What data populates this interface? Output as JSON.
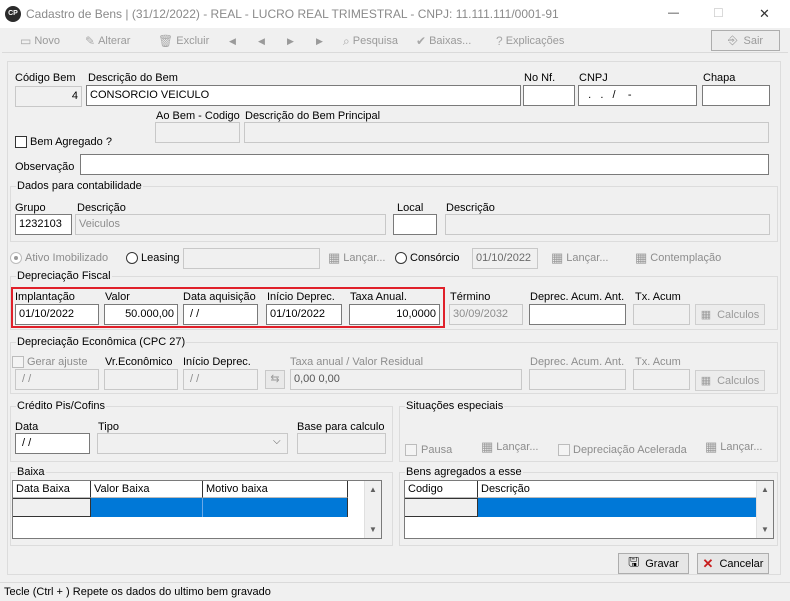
{
  "window": {
    "title": "Cadastro de Bens | (31/12/2022) - REAL - LUCRO REAL TRIMESTRAL  - CNPJ: 11.111.111/0001-91",
    "logo": "CP",
    "minimize": "—",
    "maximize": "☐",
    "close": "✕"
  },
  "toolbar": {
    "novo": "Novo",
    "alterar": "Alterar",
    "excluir": "Excluir",
    "pesquisa": "Pesquisa",
    "baixas": "Baixas...",
    "explicacoes": "Explicações",
    "sair": "Sair",
    "nav_first": "◀",
    "nav_prev": "◀",
    "nav_next": "▶",
    "nav_last": "▶"
  },
  "bem": {
    "codigo_label": "Código Bem",
    "codigo_value": "4",
    "descricao_label": "Descrição do Bem",
    "descricao_value": "CONSORCIO VEICULO",
    "nf_label": "No Nf.",
    "nf_value": "",
    "cnpj_label": "CNPJ",
    "cnpj_value": "  .   .   /    -",
    "chapa_label": "Chapa",
    "chapa_value": "",
    "agregado_label": "Bem Agregado ?",
    "ao_bem_label": "Ao Bem - Codigo",
    "desc_principal_label": "Descrição do Bem Principal",
    "observacao_label": "Observação",
    "observacao_value": ""
  },
  "contabilidade": {
    "title": "Dados para contabilidade",
    "grupo_label": "Grupo",
    "grupo_value": "1232103",
    "descricao_label": "Descrição",
    "descricao_value": "Veiculos",
    "local_label": "Local",
    "local_value": "",
    "local_desc_label": "Descrição"
  },
  "tipo": {
    "ativo_label": "Ativo Imobilizado",
    "leasing_label": "Leasing",
    "lancar1": "Lançar...",
    "consorcio_label": "Consórcio",
    "consorcio_date": "01/10/2022",
    "lancar2": "Lançar...",
    "contemplacao": "Contemplação"
  },
  "fiscal": {
    "title": "Depreciação Fiscal",
    "implantacao_label": "Implantação",
    "implantacao_value": "01/10/2022",
    "valor_label": "Valor",
    "valor_value": "50.000,00",
    "data_aquisicao_label": "Data aquisição",
    "data_aquisicao_value": " / /",
    "inicio_label": "Início Deprec.",
    "inicio_value": "01/10/2022",
    "taxa_label": "Taxa Anual.",
    "taxa_value": "10,0000",
    "termino_label": "Término",
    "termino_value": "30/09/2032",
    "deprec_acum_label": "Deprec. Acum. Ant.",
    "deprec_acum_value": "",
    "tx_acum_label": "Tx. Acum",
    "tx_acum_value": "",
    "calculos": "Calculos",
    "highlight_color": "#e0202a"
  },
  "economica": {
    "title": "Depreciação Econômica (CPC 27)",
    "gerar_label": "Gerar ajuste",
    "gerar_value": " / /",
    "vr_label": "Vr.Econômico",
    "vr_value": "",
    "inicio_label": "Início Deprec.",
    "inicio_value": " / /",
    "taxa_label": "Taxa anual / Valor Residual",
    "taxa_value": "0,00 0,00",
    "deprec_acum_label": "Deprec. Acum. Ant.",
    "tx_acum_label": "Tx. Acum",
    "calculos": "Calculos"
  },
  "credito": {
    "title": "Crédito Pis/Cofins",
    "data_label": "Data",
    "data_value": " / /",
    "tipo_label": "Tipo",
    "tipo_value": "",
    "base_label": "Base para calculo",
    "base_value": ""
  },
  "situacoes": {
    "title": "Situações especiais",
    "pausa_label": "Pausa",
    "lancar1": "Lançar...",
    "acelerada_label": "Depreciação Acelerada",
    "lancar2": "Lançar..."
  },
  "baixa": {
    "title": "Baixa",
    "columns": [
      "Data Baixa",
      "Valor Baixa",
      "Motivo baixa"
    ],
    "selected_color": "#0078d7"
  },
  "agregados": {
    "title": "Bens agregados a esse",
    "columns": [
      "Codigo",
      "Descrição"
    ]
  },
  "actions": {
    "gravar": "Gravar",
    "cancelar": "Cancelar"
  },
  "status": {
    "text": "Tecle (Ctrl + ) Repete os dados do ultimo bem gravado"
  }
}
